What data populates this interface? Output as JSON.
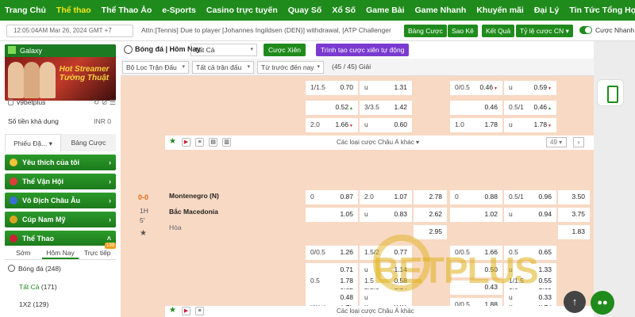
{
  "nav": [
    "Trang Chủ",
    "Thể thao",
    "Thể Thao Ảo",
    "e-Sports",
    "Casino trực tuyến",
    "Quay Số",
    "Xổ Số",
    "Game Bài",
    "Game Nhanh",
    "Khuyến mãi",
    "Đại Lý",
    "Tin Tức Tổng Hợp"
  ],
  "infobar": {
    "clock": "12:05:04AM Mar 26, 2024 GMT +7",
    "ticker": "Attn:[Tennis] Due to player [Johannes Ingildsen (DEN)] withdrawal, [ATP Challenger",
    "buttons": [
      "Bảng Cược",
      "Sao Kê",
      "Kết Quả",
      "Tỷ lệ cược CN"
    ],
    "toggle_label": "Cược Nhanh"
  },
  "sidebar": {
    "galaxy": "Galaxy",
    "banner_text": "Hot Streamer Tường Thuật",
    "username": "v9betplus",
    "balance_label": "Số tiền khả dụng",
    "balance_value": "INR 0",
    "tabs": [
      "Phiếu Đặ...",
      "Bảng Cược"
    ],
    "categories": [
      "Yêu thích của tôi",
      "Thể Vận Hội",
      "Vô Địch Châu Âu",
      "Cúp Nam Mỹ",
      "Thể Thao"
    ],
    "subtabs": [
      "Sớm",
      "Hôm Nay",
      "Trực tiếp"
    ],
    "badge": "139",
    "sport": "Bóng đá",
    "sport_count": "(248)",
    "filters": [
      {
        "label": "Tất Cả",
        "count": "(171)"
      },
      {
        "label": "1X2",
        "count": "(129)"
      }
    ]
  },
  "main": {
    "title": "Bóng đá | Hôm Nay",
    "select": "Tất Cả",
    "btn_parlay": "Cược Xiên",
    "btn_auto": "Trình tạo cược xiên tự động",
    "filter1": "Bộ Lọc Trận Đấu",
    "filter2": "Tất cả trận đấu",
    "filter3": "Từ trước đến nay",
    "pagination": "(45 / 45) Giải",
    "more_bets": "Các loại cược Châu Á khác",
    "count": "49",
    "match": {
      "score": "0-0",
      "half": "1H",
      "minute": "5'",
      "home": "Montenegro (N)",
      "away": "Bắc Macedonia",
      "draw": "Hòa"
    }
  },
  "watermark": "BETPLUS",
  "colors": {
    "brand": "#1f8b1c",
    "accent": "#f5e51a",
    "row_bg": "#f8d9c4"
  }
}
